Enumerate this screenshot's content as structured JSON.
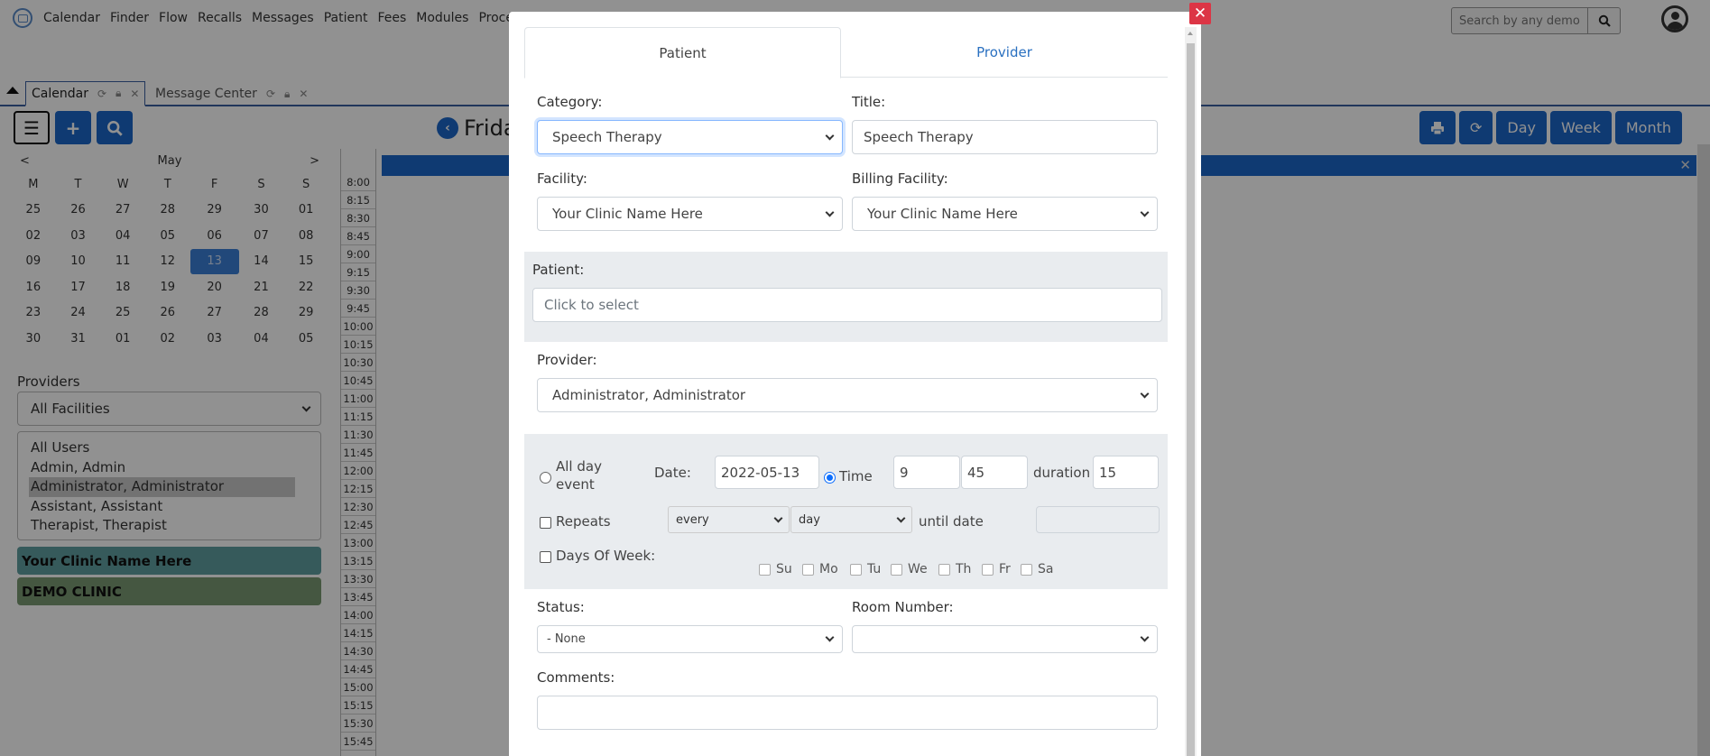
{
  "nav": {
    "items": [
      "Calendar",
      "Finder",
      "Flow",
      "Recalls",
      "Messages",
      "Patient",
      "Fees",
      "Modules",
      "Procedures"
    ],
    "search_placeholder": "Search by any demographi"
  },
  "tabs": [
    {
      "label": "Calendar",
      "active": true
    },
    {
      "label": "Message Center",
      "active": false
    }
  ],
  "calendar": {
    "month": "May",
    "prev": "<",
    "next": ">",
    "weekdays": [
      "M",
      "T",
      "W",
      "T",
      "F",
      "S",
      "S"
    ],
    "weeks": [
      [
        "25",
        "26",
        "27",
        "28",
        "29",
        "30",
        "01"
      ],
      [
        "02",
        "03",
        "04",
        "05",
        "06",
        "07",
        "08"
      ],
      [
        "09",
        "10",
        "11",
        "12",
        "13",
        "14",
        "15"
      ],
      [
        "16",
        "17",
        "18",
        "19",
        "20",
        "21",
        "22"
      ],
      [
        "23",
        "24",
        "25",
        "26",
        "27",
        "28",
        "29"
      ],
      [
        "30",
        "31",
        "01",
        "02",
        "03",
        "04",
        "05"
      ]
    ],
    "selected_day": "13",
    "day_title": "Frida"
  },
  "providers": {
    "label": "Providers",
    "facility": "All Facilities",
    "users": [
      "All Users",
      "Admin, Admin",
      "Administrator, Administrator",
      "Assistant, Assistant",
      "Therapist, Therapist"
    ],
    "selected_user": "Administrator, Administrator",
    "facilities": [
      {
        "name": "Your Clinic Name Here",
        "color": "#5f9ea0"
      },
      {
        "name": "DEMO CLINIC",
        "color": "#7a9a72"
      }
    ]
  },
  "view_buttons": [
    "Day",
    "Week",
    "Month"
  ],
  "time_slots": [
    "8:00",
    "8:15",
    "8:30",
    "8:45",
    "9:00",
    "9:15",
    "9:30",
    "9:45",
    "10:00",
    "10:15",
    "10:30",
    "10:45",
    "11:00",
    "11:15",
    "11:30",
    "11:45",
    "12:00",
    "12:15",
    "12:30",
    "12:45",
    "13:00",
    "13:15",
    "13:30",
    "13:45",
    "14:00",
    "14:15",
    "14:30",
    "14:45",
    "15:00",
    "15:15",
    "15:30",
    "15:45"
  ],
  "modal": {
    "tabs": [
      "Patient",
      "Provider"
    ],
    "active_tab": "Patient",
    "category_label": "Category:",
    "category_value": "Speech Therapy",
    "title_label": "Title:",
    "title_value": "Speech Therapy",
    "facility_label": "Facility:",
    "facility_value": "Your Clinic Name Here",
    "billing_label": "Billing Facility:",
    "billing_value": "Your Clinic Name Here",
    "patient_label": "Patient:",
    "patient_placeholder": "Click to select",
    "provider_label": "Provider:",
    "provider_value": "Administrator, Administrator",
    "allday_label_1": "All day",
    "allday_label_2": "event",
    "date_label": "Date:",
    "date_value": "2022-05-13",
    "time_label": "Time",
    "hour_value": "9",
    "minute_value": "45",
    "duration_label": "duration",
    "duration_value": "15",
    "repeats_label": "Repeats",
    "repeat_freq": "every",
    "repeat_unit": "day",
    "until_label": "until date",
    "until_value": "",
    "dow_label": "Days Of Week:",
    "days": [
      "Su",
      "Mo",
      "Tu",
      "We",
      "Th",
      "Fr",
      "Sa"
    ],
    "status_label": "Status:",
    "status_value": "- None",
    "room_label": "Room Number:",
    "room_value": "",
    "comments_label": "Comments:",
    "comments_value": ""
  },
  "colors": {
    "primary": "#1c66c8",
    "close": "#dc3545",
    "band": "#e9ecef"
  }
}
